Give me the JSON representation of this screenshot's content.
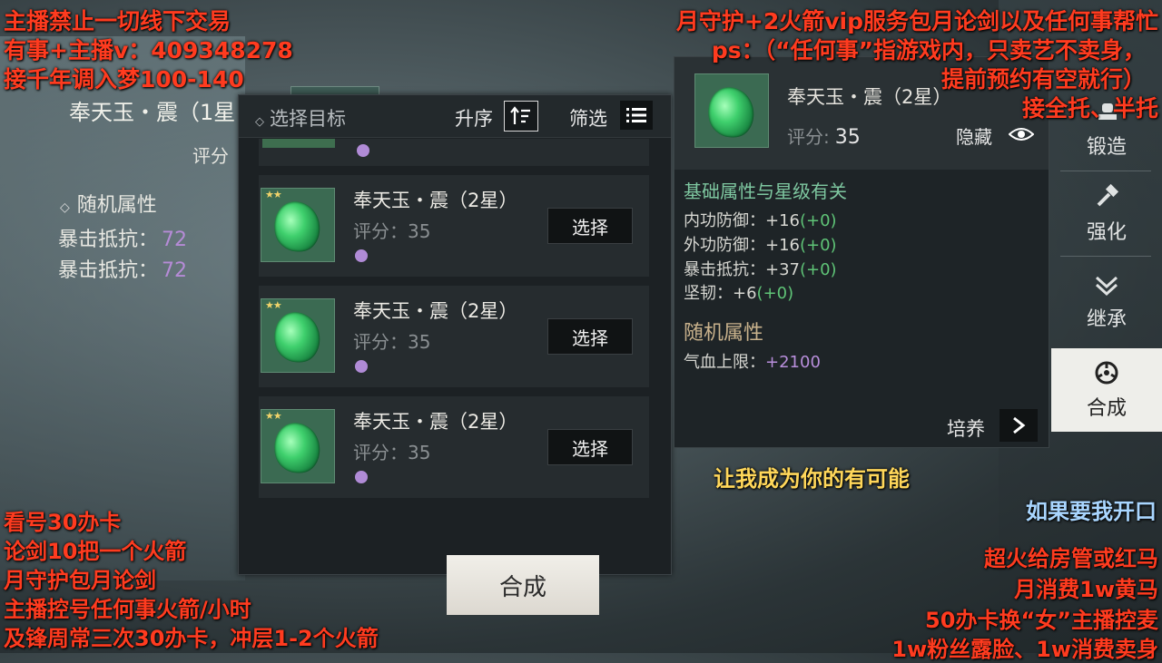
{
  "background": {
    "item_name": "奉天玉・震（1星",
    "score_label": "评分",
    "random_attr_title": "随机属性",
    "stats": [
      {
        "label": "暴击抵抗：",
        "value": "72"
      },
      {
        "label": "暴击抵抗：",
        "value": "72"
      }
    ]
  },
  "select_panel": {
    "title": "选择目标",
    "sort_label": "升序",
    "filter_label": "筛选",
    "items": [
      {
        "name": "奉天玉・震（2星）",
        "score": "评分：35",
        "button": "选择"
      },
      {
        "name": "奉天玉・震（2星）",
        "score": "评分：35",
        "button": "选择"
      },
      {
        "name": "奉天玉・震（2星）",
        "score": "评分：35",
        "button": "选择"
      }
    ],
    "merge_button": "合成"
  },
  "detail": {
    "name": "奉天玉・震（2星）",
    "score_label": "评分:",
    "score_value": "35",
    "hide_label": "隐藏",
    "base_title": "基础属性与星级有关",
    "attrs": [
      {
        "label": "内功防御：",
        "value": "+16",
        "bonus": "(+0)"
      },
      {
        "label": "外功防御：",
        "value": "+16",
        "bonus": "(+0)"
      },
      {
        "label": "暴击抵抗：",
        "value": "+37",
        "bonus": "(+0)"
      },
      {
        "label": "坚韧：",
        "value": "+6",
        "bonus": "(+0)"
      }
    ],
    "random_title": "随机属性",
    "random_attr": {
      "label": "气血上限：",
      "value": "+2100"
    },
    "cultivate_label": "培养"
  },
  "right_tabs": [
    {
      "label": "锻造",
      "icon": "anvil-icon",
      "active": false
    },
    {
      "label": "强化",
      "icon": "hammer-icon",
      "active": false
    },
    {
      "label": "继承",
      "icon": "inherit-icon",
      "active": false
    },
    {
      "label": "合成",
      "icon": "merge-icon",
      "active": true
    }
  ],
  "overlay": {
    "top_left": [
      "主播禁止一切线下交易",
      "有事+主播v：409348278",
      "接千年调入梦100-140"
    ],
    "top_right": [
      "月守护+2火箭vip服务包月论剑以及任何事帮忙",
      "ps：（“任何事”指游戏内，只卖艺不卖身，",
      "提前预约有空就行）",
      "接全托、半托"
    ],
    "center_bottom": "让我成为你的有可能",
    "right_mid": "如果要我开口",
    "bottom_left": [
      "看号30办卡",
      "论剑10把一个火箭",
      "月守护包月论剑",
      "主播控号任何事火箭/小时",
      "及锋周常三次30办卡，冲层1-2个火箭"
    ],
    "bottom_right": [
      "超火给房管或红马",
      "月消费1w黄马",
      "50办卡换“女”主播控麦",
      "1w粉丝露脸、1w消费卖身"
    ]
  },
  "colors": {
    "overlay_red": "#ff3b1f",
    "overlay_orange": "#ff8a1c",
    "green_bonus": "#5fc477",
    "purple_value": "#b88edb"
  }
}
